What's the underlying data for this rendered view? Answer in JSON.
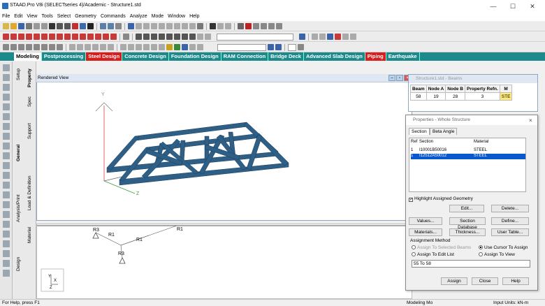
{
  "window": {
    "title": "STAAD.Pro V8i (SELECTseries 4)/Academic - Structure1.std",
    "minimize": "—",
    "maximize": "☐",
    "close": "✕"
  },
  "menu": [
    "File",
    "Edit",
    "View",
    "Tools",
    "Select",
    "Geometry",
    "Commands",
    "Analyze",
    "Mode",
    "Window",
    "Help"
  ],
  "tabs": [
    {
      "label": "Modeling",
      "active": true
    },
    {
      "label": "Postprocessing"
    },
    {
      "label": "Steel Design",
      "red": true
    },
    {
      "label": "Concrete Design"
    },
    {
      "label": "Foundation Design"
    },
    {
      "label": "RAM Connection"
    },
    {
      "label": "Bridge Deck"
    },
    {
      "label": "Advanced Slab Design"
    },
    {
      "label": "Piping",
      "red": true
    },
    {
      "label": "Earthquake"
    }
  ],
  "vertical_tabs": {
    "setup": "Setup",
    "property": "Property",
    "geometry": "Geometry",
    "spec": "Spec",
    "general": "General",
    "support": "Support",
    "analysis": "Analysis/Print",
    "load": "Load & Definition",
    "design": "Design",
    "material": "Material"
  },
  "view": {
    "title": "Rendered View",
    "axis_y": "Y",
    "axis_z": "Z",
    "labels": [
      "R3",
      "R1",
      "R1",
      "R1",
      "R3"
    ],
    "gizmo_y": "Y",
    "gizmo_x": "X",
    "gizmo_z": "Z"
  },
  "beams": {
    "title": "Structure1.std - Beams",
    "columns": [
      "Beam",
      "Node A",
      "Node B",
      "Property Refn.",
      "M"
    ],
    "rows": [
      [
        "58",
        "19",
        "28",
        "3",
        "STE"
      ]
    ]
  },
  "properties": {
    "title": "Properties - Whole Structure",
    "tab_section": "Section",
    "tab_beta": "Beta Angle",
    "col_ref": "Ref",
    "col_section": "Section",
    "col_material": "Material",
    "rows": [
      {
        "ref": "1",
        "section": "I10001B50016",
        "material": "STEEL"
      },
      {
        "ref": "1",
        "section": "I12512A50012",
        "material": "STEEL"
      }
    ],
    "highlight": "Highlight Assigned Geometry",
    "buttons": {
      "edit": "Edit...",
      "delete": "Delete...",
      "values": "Values...",
      "section_db": "Section Database",
      "define": "Define...",
      "materials": "Materials...",
      "thickness": "Thickness...",
      "user_table": "User Table...",
      "assign": "Assign",
      "close": "Close",
      "help": "Help"
    },
    "assignment_method": "Assignment Method",
    "opt_selected": "Assign To Selected Beams",
    "opt_cursor": "Use Cursor To Assign",
    "opt_edit": "Assign To Edit List",
    "opt_view": "Assign To View",
    "edit_list_value": "55 To 58"
  },
  "status": {
    "left": "For Help, press F1",
    "mode": "Modeling Mo",
    "units": "Input Units: kN-m"
  },
  "colors": {
    "tabbar": "#1c8a8c",
    "truss": "#2e5f87",
    "selected": "#0a58d0"
  }
}
